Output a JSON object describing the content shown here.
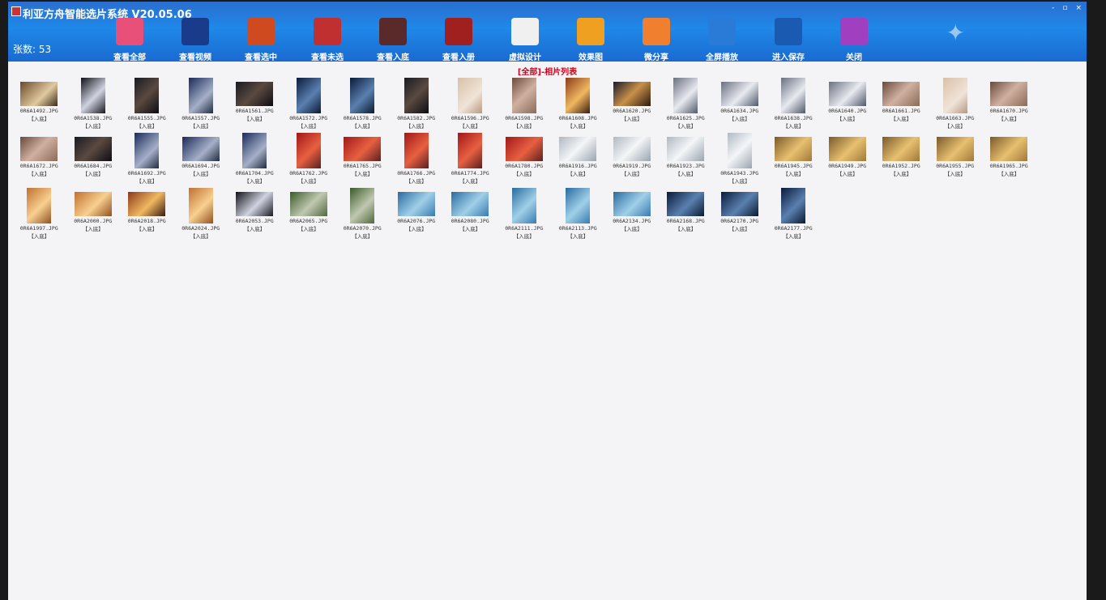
{
  "window": {
    "title": "利亚方舟智能选片系统 V20.05.06",
    "controls": [
      "-",
      "▫",
      "×"
    ]
  },
  "count_label": "张数: 53",
  "toolbar": [
    {
      "label": "查看全部",
      "icon": "calendar-grid-icon",
      "color": "#e8507a"
    },
    {
      "label": "查看视频",
      "icon": "video-mp4-icon",
      "color": "#1a3a8a"
    },
    {
      "label": "查看选中",
      "icon": "selected-photo-icon",
      "color": "#d04a20"
    },
    {
      "label": "查看未选",
      "icon": "unselected-folder-icon",
      "color": "#c03030"
    },
    {
      "label": "查看入底",
      "icon": "film-strip-icon",
      "color": "#5a2a2a"
    },
    {
      "label": "查看入册",
      "icon": "album-book-icon",
      "color": "#a02020"
    },
    {
      "label": "虚拟设计",
      "icon": "design-document-icon",
      "color": "#f0f0f0"
    },
    {
      "label": "效果图",
      "icon": "puzzle-icon",
      "color": "#f0a020"
    },
    {
      "label": "微分享",
      "icon": "aperture-share-icon",
      "color": "#f08030"
    },
    {
      "label": "全屏播放",
      "icon": "fullscreen-icon",
      "color": "#2a7ad8"
    },
    {
      "label": "进入保存",
      "icon": "save-disk-icon",
      "color": "#1a5ab0"
    },
    {
      "label": "关闭",
      "icon": "exit-door-icon",
      "color": "#a040c0"
    }
  ],
  "list_header": "[全部]-相片列表",
  "photos": [
    {
      "name": "0R6A1492.JPG",
      "tag": "【入底】",
      "shape": "l",
      "tone": "c0"
    },
    {
      "name": "0R6A1538.JPG",
      "tag": "【入底】",
      "shape": "p",
      "tone": "c1"
    },
    {
      "name": "0R6A1555.JPG",
      "tag": "【入底】",
      "shape": "p",
      "tone": "c2"
    },
    {
      "name": "0R6A1557.JPG",
      "tag": "【入底】",
      "shape": "p",
      "tone": "c3"
    },
    {
      "name": "0R6A1561.JPG",
      "tag": "【入底】",
      "shape": "l",
      "tone": "c2"
    },
    {
      "name": "0R6A1572.JPG",
      "tag": "【入底】",
      "shape": "p",
      "tone": "c13"
    },
    {
      "name": "0R6A1578.JPG",
      "tag": "【入底】",
      "shape": "p",
      "tone": "c13"
    },
    {
      "name": "0R6A1582.JPG",
      "tag": "【入底】",
      "shape": "p",
      "tone": "c2"
    },
    {
      "name": "0R6A1596.JPG",
      "tag": "【入底】",
      "shape": "p",
      "tone": "c4"
    },
    {
      "name": "0R6A1598.JPG",
      "tag": "【入底】",
      "shape": "p",
      "tone": "c8"
    },
    {
      "name": "0R6A1608.JPG",
      "tag": "【入底】",
      "shape": "p",
      "tone": "c5"
    },
    {
      "name": "0R6A1620.JPG",
      "tag": "【入底】",
      "shape": "l",
      "tone": "c6"
    },
    {
      "name": "0R6A1625.JPG",
      "tag": "【入底】",
      "shape": "p",
      "tone": "c7"
    },
    {
      "name": "0R6A1634.JPG",
      "tag": "【入底】",
      "shape": "l",
      "tone": "c7"
    },
    {
      "name": "0R6A1638.JPG",
      "tag": "【入底】",
      "shape": "p",
      "tone": "c7"
    },
    {
      "name": "0R6A1640.JPG",
      "tag": "【入底】",
      "shape": "l",
      "tone": "c7"
    },
    {
      "name": "0R6A1661.JPG",
      "tag": "【入底】",
      "shape": "l",
      "tone": "c8"
    },
    {
      "name": "0R6A1663.JPG",
      "tag": "【入底】",
      "shape": "p",
      "tone": "c4"
    },
    {
      "name": "0R6A1670.JPG",
      "tag": "【入底】",
      "shape": "l",
      "tone": "c8"
    },
    {
      "name": "0R6A1672.JPG",
      "tag": "【入底】",
      "shape": "l",
      "tone": "c8"
    },
    {
      "name": "0R6A1684.JPG",
      "tag": "【入底】",
      "shape": "l",
      "tone": "c2"
    },
    {
      "name": "0R6A1692.JPG",
      "tag": "【入底】",
      "shape": "p",
      "tone": "c3"
    },
    {
      "name": "0R6A1694.JPG",
      "tag": "【入底】",
      "shape": "l",
      "tone": "c3"
    },
    {
      "name": "0R6A1704.JPG",
      "tag": "【入底】",
      "shape": "p",
      "tone": "c3"
    },
    {
      "name": "0R6A1762.JPG",
      "tag": "【入底】",
      "shape": "p",
      "tone": "c9"
    },
    {
      "name": "0R6A1765.JPG",
      "tag": "【入底】",
      "shape": "l",
      "tone": "c9"
    },
    {
      "name": "0R6A1766.JPG",
      "tag": "【入底】",
      "shape": "p",
      "tone": "c9"
    },
    {
      "name": "0R6A1774.JPG",
      "tag": "【入底】",
      "shape": "p",
      "tone": "c9"
    },
    {
      "name": "0R6A1780.JPG",
      "tag": "【入底】",
      "shape": "l",
      "tone": "c9"
    },
    {
      "name": "0R6A1916.JPG",
      "tag": "【入底】",
      "shape": "l",
      "tone": "c10"
    },
    {
      "name": "0R6A1919.JPG",
      "tag": "【入底】",
      "shape": "l",
      "tone": "c10"
    },
    {
      "name": "0R6A1923.JPG",
      "tag": "【入底】",
      "shape": "l",
      "tone": "c10"
    },
    {
      "name": "0R6A1943.JPG",
      "tag": "【入底】",
      "shape": "p",
      "tone": "c10"
    },
    {
      "name": "0R6A1945.JPG",
      "tag": "【入底】",
      "shape": "l",
      "tone": "c11"
    },
    {
      "name": "0R6A1949.JPG",
      "tag": "【入底】",
      "shape": "l",
      "tone": "c11"
    },
    {
      "name": "0R6A1952.JPG",
      "tag": "【入底】",
      "shape": "l",
      "tone": "c11"
    },
    {
      "name": "0R6A1955.JPG",
      "tag": "【入底】",
      "shape": "l",
      "tone": "c11"
    },
    {
      "name": "0R6A1965.JPG",
      "tag": "【入底】",
      "shape": "l",
      "tone": "c11"
    },
    {
      "name": "0R6A1997.JPG",
      "tag": "【入底】",
      "shape": "p",
      "tone": "c15"
    },
    {
      "name": "0R6A2000.JPG",
      "tag": "【入底】",
      "shape": "l",
      "tone": "c15"
    },
    {
      "name": "0R6A2018.JPG",
      "tag": "【入底】",
      "shape": "l",
      "tone": "c5"
    },
    {
      "name": "0R6A2024.JPG",
      "tag": "【入底】",
      "shape": "p",
      "tone": "c15"
    },
    {
      "name": "0R6A2053.JPG",
      "tag": "【入底】",
      "shape": "l",
      "tone": "c1"
    },
    {
      "name": "0R6A2065.JPG",
      "tag": "【入底】",
      "shape": "l",
      "tone": "c14"
    },
    {
      "name": "0R6A2070.JPG",
      "tag": "【入底】",
      "shape": "p",
      "tone": "c14"
    },
    {
      "name": "0R6A2076.JPG",
      "tag": "【入底】",
      "shape": "l",
      "tone": "c12"
    },
    {
      "name": "0R6A2080.JPG",
      "tag": "【入底】",
      "shape": "l",
      "tone": "c12"
    },
    {
      "name": "0R6A2111.JPG",
      "tag": "【入底】",
      "shape": "p",
      "tone": "c12"
    },
    {
      "name": "0R6A2113.JPG",
      "tag": "【入底】",
      "shape": "p",
      "tone": "c12"
    },
    {
      "name": "0R6A2134.JPG",
      "tag": "【入底】",
      "shape": "l",
      "tone": "c12"
    },
    {
      "name": "0R6A2168.JPG",
      "tag": "【入底】",
      "shape": "l",
      "tone": "c13"
    },
    {
      "name": "0R6A2170.JPG",
      "tag": "【入底】",
      "shape": "l",
      "tone": "c13"
    },
    {
      "name": "0R6A2177.JPG",
      "tag": "【入底】",
      "shape": "p",
      "tone": "c13"
    }
  ]
}
